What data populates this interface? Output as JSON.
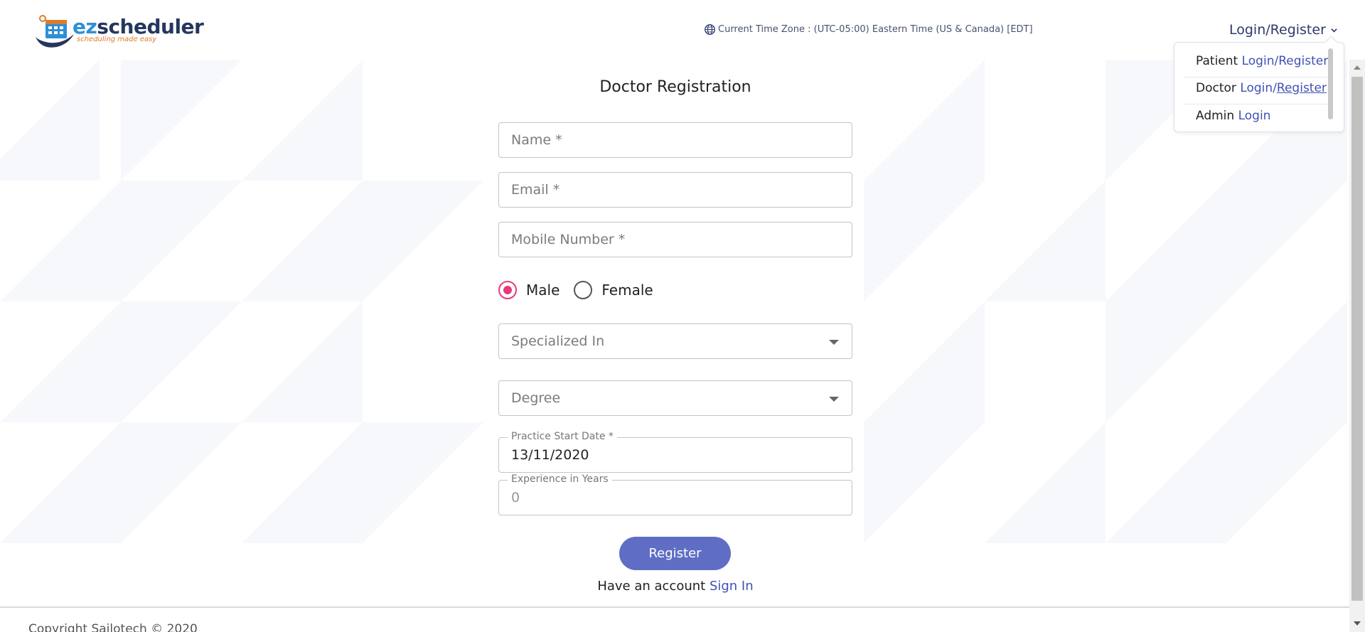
{
  "header": {
    "logo_brand_prefix": "ez",
    "logo_brand_suffix": "scheduler",
    "logo_tagline": "scheduling made easy",
    "timezone_text": "Current Time Zone : (UTC-05:00) Eastern Time (US & Canada) [EDT]",
    "login_register": "Login/Register"
  },
  "dropdown": {
    "patient_prefix": "Patient",
    "patient_login": "Login",
    "patient_sep": "/",
    "patient_register": "Register",
    "doctor_prefix": "Doctor",
    "doctor_login": "Login",
    "doctor_sep": "/",
    "doctor_register": "Register",
    "admin_prefix": "Admin",
    "admin_login": "Login"
  },
  "form": {
    "title": "Doctor Registration",
    "name_placeholder": "Name *",
    "email_placeholder": "Email *",
    "mobile_placeholder": "Mobile Number *",
    "gender_options": [
      "Male",
      "Female"
    ],
    "gender_selected": "Male",
    "specialized_placeholder": "Specialized In",
    "degree_placeholder": "Degree",
    "practice_start_label": "Practice Start Date *",
    "practice_start_value": "13/11/2020",
    "experience_label": "Experience in Years",
    "experience_value": "0",
    "register_label": "Register",
    "have_account_text": "Have an account",
    "sign_in_link": "Sign In"
  },
  "footer": {
    "copyright": "Copyright Sailotech © 2020"
  },
  "colors": {
    "accent": "#5f6ec4",
    "link": "#3f51b5",
    "radio_selected": "#e53b7b",
    "brand_navy": "#25365f"
  }
}
